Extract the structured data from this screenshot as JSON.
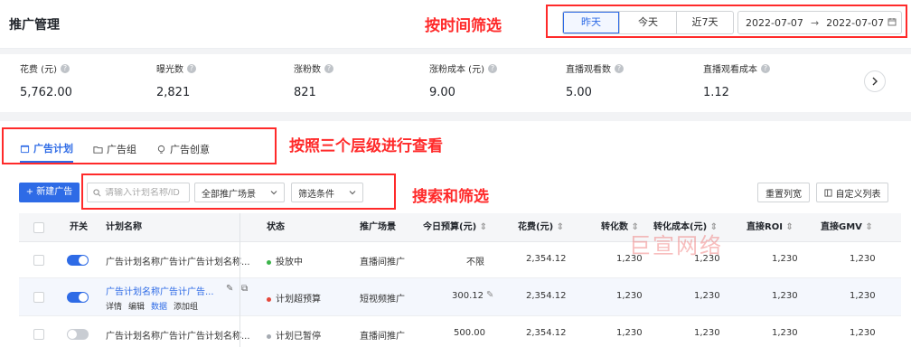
{
  "header": {
    "title": "推广管理",
    "time_segments": [
      {
        "label": "昨天",
        "active": true
      },
      {
        "label": "今天",
        "active": false
      },
      {
        "label": "近7天",
        "active": false
      }
    ],
    "date_start": "2022-07-07",
    "date_arrow": "→",
    "date_end": "2022-07-07"
  },
  "annotations": {
    "time_filter": "按时间筛选",
    "levels": "按照三个层级进行查看",
    "search_filter": "搜索和筛选"
  },
  "metrics": [
    {
      "label": "花费 (元)",
      "value": "5,762.00"
    },
    {
      "label": "曝光数",
      "value": "2,821"
    },
    {
      "label": "涨粉数",
      "value": "821"
    },
    {
      "label": "涨粉成本 (元)",
      "value": "9.00"
    },
    {
      "label": "直播观看数",
      "value": "5.00"
    },
    {
      "label": "直播观看成本",
      "value": "1.12"
    }
  ],
  "tabs": [
    {
      "label": "广告计划",
      "icon": "calendar-icon",
      "active": true
    },
    {
      "label": "广告组",
      "icon": "folder-icon",
      "active": false
    },
    {
      "label": "广告创意",
      "icon": "bulb-icon",
      "active": false
    }
  ],
  "toolbar": {
    "new_button": "+ 新建广告",
    "search_placeholder": "请输入计划名称/ID",
    "scene_dropdown": "全部推广场景",
    "filter_dropdown": "筛选条件",
    "reset_columns": "重置列宽",
    "custom_columns": "自定义列表"
  },
  "table": {
    "columns": [
      "开关",
      "计划名称",
      "状态",
      "推广场景",
      "今日预算(元)",
      "花费(元)",
      "转化数",
      "转化成本(元)",
      "直接ROI",
      "直接GMV"
    ],
    "rows": [
      {
        "switch": "on",
        "name": "广告计划名称广告计广告计划名称...",
        "status": "投放中",
        "status_color": "#3bb44a",
        "scene": "直播间推广",
        "budget": "不限",
        "cost": "2,354.12",
        "conversions": "1,230",
        "conv_cost": "1,230",
        "roi": "1,230",
        "gmv": "1,230"
      },
      {
        "switch": "on",
        "name": "广告计划名称广告计广告...",
        "status": "计划超预算",
        "status_color": "#e5483b",
        "scene": "短视频推广",
        "budget": "300.12",
        "cost": "2,354.12",
        "conversions": "1,230",
        "conv_cost": "1,230",
        "roi": "1,230",
        "gmv": "1,230",
        "links": [
          "详情",
          "编辑",
          "数据",
          "添加组"
        ]
      },
      {
        "switch": "off",
        "name": "广告计划名称广告计广告计划名称...",
        "status": "计划已暂停",
        "status_color": "#a6abb2",
        "scene": "直播间推广",
        "budget": "500.00",
        "cost": "2,354.12",
        "conversions": "1,230",
        "conv_cost": "1,230",
        "roi": "1,230",
        "gmv": "1,230"
      }
    ]
  },
  "watermark": "巨宣网络",
  "colors": {
    "accent": "#2e6be6",
    "annotation": "#ff2a2a"
  }
}
